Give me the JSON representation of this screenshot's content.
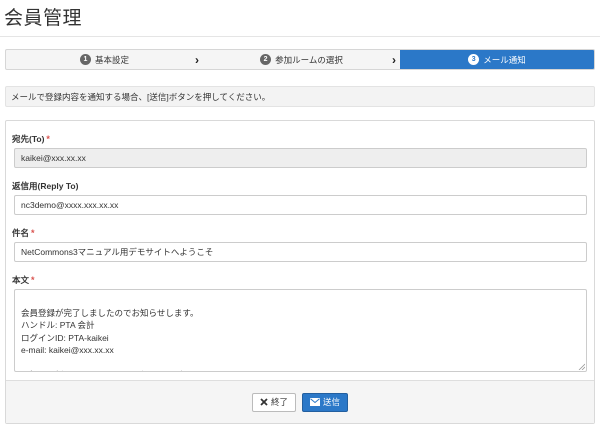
{
  "page": {
    "title": "会員管理"
  },
  "wizard": {
    "steps": [
      {
        "number": "1",
        "label": "基本設定"
      },
      {
        "number": "2",
        "label": "参加ルームの選択"
      },
      {
        "number": "3",
        "label": "メール通知"
      }
    ],
    "active_step": 3,
    "colors": {
      "active": "#2b78c8",
      "inactive": "#f5f5f5"
    }
  },
  "info": {
    "message": "メールで登録内容を通知する場合、[送信]ボタンを押してください。"
  },
  "form": {
    "to": {
      "label": "宛先(To)",
      "required": "*",
      "value": "kaikei@xxx.xx.xx"
    },
    "reply_to": {
      "label": "返信用(Reply To)",
      "value": "nc3demo@xxxx.xxx.xx.xx"
    },
    "subject": {
      "label": "件名",
      "required": "*",
      "value": "NetCommons3マニュアル用デモサイトへようこそ"
    },
    "body": {
      "label": "本文",
      "required": "*",
      "value": "会員登録が完了しましたのでお知らせします。\nハンドル: PTA 会計\nログインID: PTA-kaikei\ne-mail: kaikei@xxx.xx.xx\n\n下記から新たにパスワードを取得し、ログインてください。"
    }
  },
  "buttons": {
    "cancel": {
      "label": "終了",
      "icon": "close-icon"
    },
    "send": {
      "label": "送信",
      "icon": "envelope-icon"
    }
  }
}
